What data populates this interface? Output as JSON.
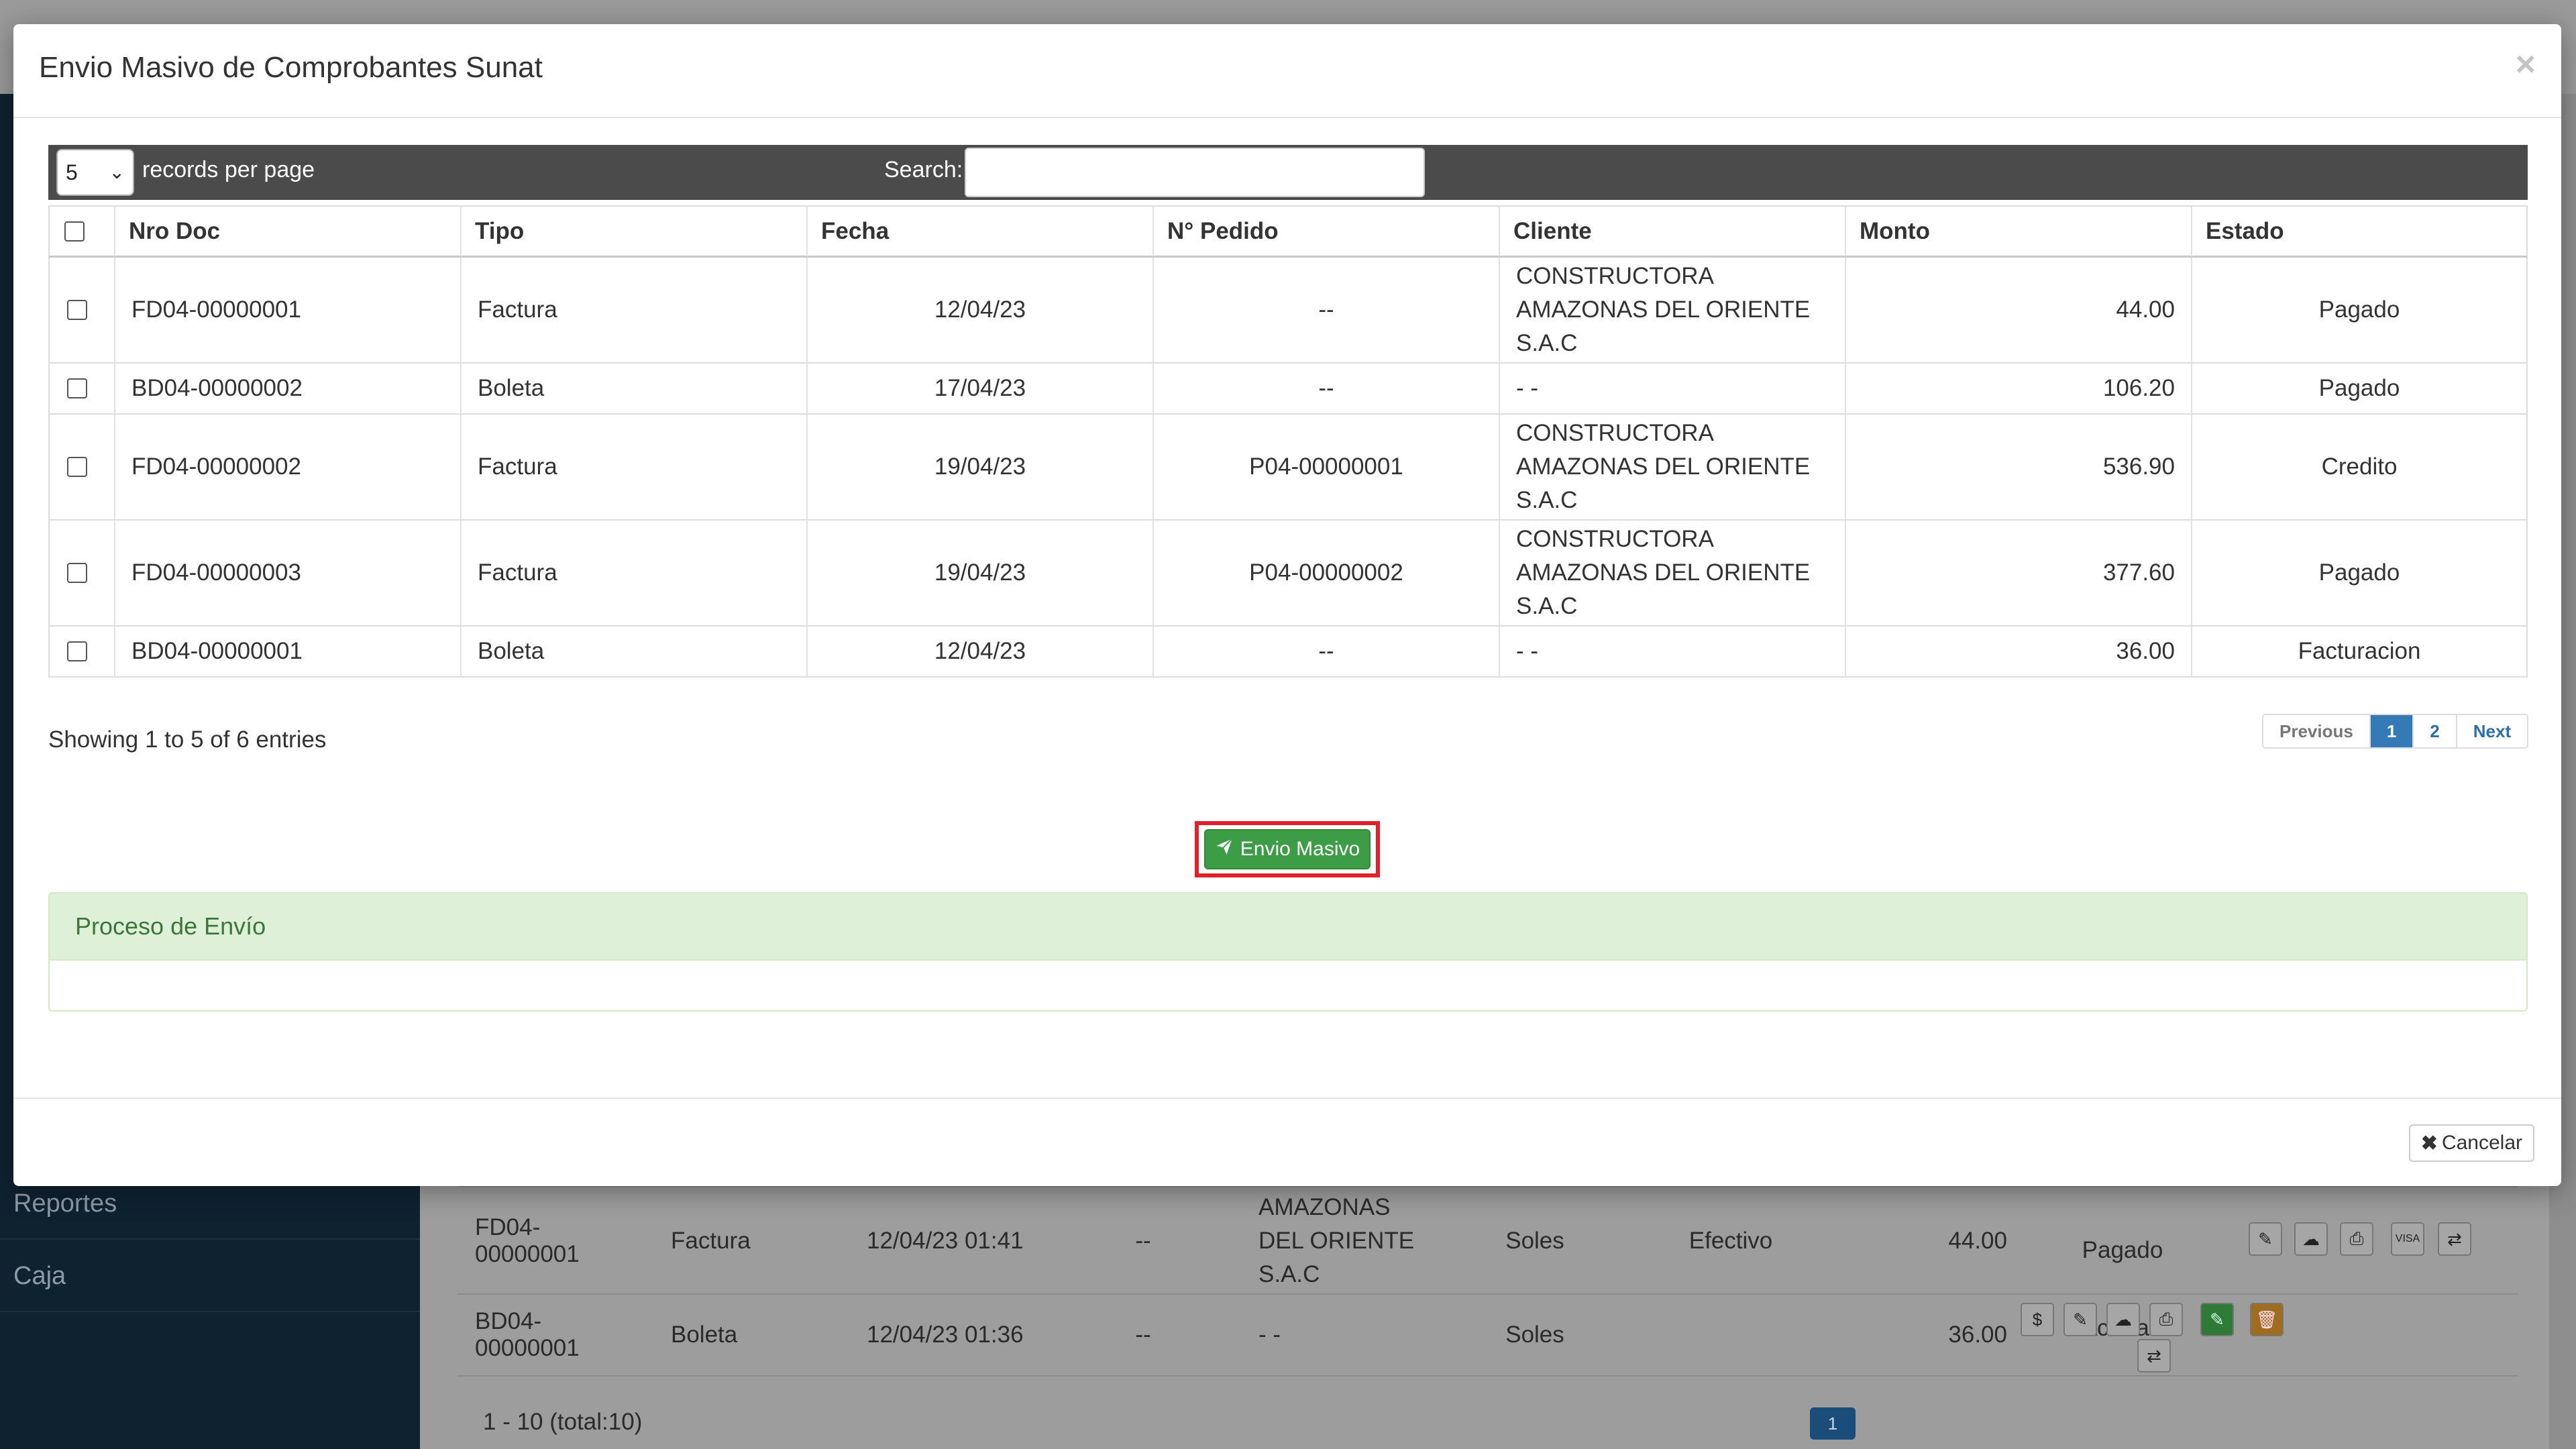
{
  "background": {
    "menu": [
      "Reportes",
      "Caja"
    ],
    "rows": [
      {
        "doc": "FD04-00000001",
        "tipo": "Factura",
        "fecha": "12/04/23 01:41",
        "pedido": "--",
        "cliente": "AMAZONAS DEL ORIENTE S.A.C",
        "moneda": "Soles",
        "pago": "Efectivo",
        "monto": "44.00",
        "estado": "Pagado"
      },
      {
        "doc": "BD04-00000001",
        "tipo": "Boleta",
        "fecha": "12/04/23 01:36",
        "pedido": "--",
        "cliente": "- -",
        "moneda": "Soles",
        "pago": "",
        "monto": "36.00",
        "estado": "Facturado"
      }
    ],
    "footer_text": "1 - 10 (total:10)",
    "page_badge": "1"
  },
  "modal": {
    "title": "Envio Masivo de Comprobantes Sunat",
    "close": "×",
    "length_value": "5",
    "length_label": "records per page",
    "search_label": "Search:",
    "search_value": "",
    "headers": [
      "Nro Doc",
      "Tipo",
      "Fecha",
      "N° Pedido",
      "Cliente",
      "Monto",
      "Estado"
    ],
    "rows": [
      {
        "doc": "FD04-00000001",
        "tipo": "Factura",
        "fecha": "12/04/23",
        "pedido": "--",
        "cliente": "CONSTRUCTORA AMAZONAS DEL ORIENTE S.A.C",
        "monto": "44.00",
        "estado": "Pagado"
      },
      {
        "doc": "BD04-00000002",
        "tipo": "Boleta",
        "fecha": "17/04/23",
        "pedido": "--",
        "cliente": "- -",
        "monto": "106.20",
        "estado": "Pagado"
      },
      {
        "doc": "FD04-00000002",
        "tipo": "Factura",
        "fecha": "19/04/23",
        "pedido": "P04-00000001",
        "cliente": "CONSTRUCTORA AMAZONAS DEL ORIENTE S.A.C",
        "monto": "536.90",
        "estado": "Credito"
      },
      {
        "doc": "FD04-00000003",
        "tipo": "Factura",
        "fecha": "19/04/23",
        "pedido": "P04-00000002",
        "cliente": "CONSTRUCTORA AMAZONAS DEL ORIENTE S.A.C",
        "monto": "377.60",
        "estado": "Pagado"
      },
      {
        "doc": "BD04-00000001",
        "tipo": "Boleta",
        "fecha": "12/04/23",
        "pedido": "--",
        "cliente": "- -",
        "monto": "36.00",
        "estado": "Facturacion"
      }
    ],
    "info": "Showing 1 to 5 of 6 entries",
    "pager": {
      "previous": "Previous",
      "pages": [
        "1",
        "2"
      ],
      "next": "Next"
    },
    "envio_label": "Envio Masivo",
    "panel_title": "Proceso de Envío",
    "cancel_label": "Cancelar",
    "colors": {
      "accent_green": "#3d9c46",
      "highlight_red": "#e0202a",
      "panel_green": "#dff0d8",
      "pager_blue": "#337ab7"
    }
  }
}
